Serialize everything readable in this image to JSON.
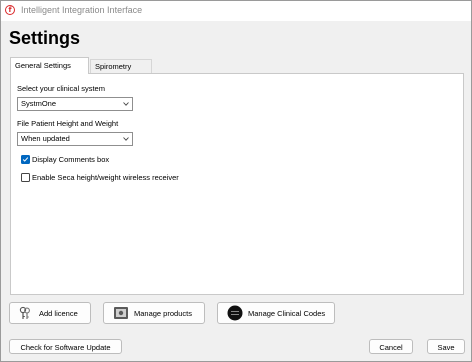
{
  "window": {
    "title": "Intelligent Integration Interface",
    "icon": "app-logo-icon"
  },
  "page": {
    "title": "Settings"
  },
  "tabs": [
    {
      "label": "General Settings",
      "active": true
    },
    {
      "label": "Spirometry Settings",
      "active": false
    }
  ],
  "general": {
    "clinical_system_label": "Select your clinical system",
    "clinical_system_value": "SystmOne",
    "file_height_weight_label": "File Patient Height and Weight",
    "file_height_weight_value": "When updated",
    "display_comments_label": "Display Comments box",
    "display_comments_checked": true,
    "seca_label": "Enable Seca height/weight wireless receiver",
    "seca_checked": false
  },
  "buttons": {
    "add_licence": "Add licence",
    "manage_products": "Manage products",
    "manage_clinical_codes": "Manage Clinical Codes",
    "check_update": "Check for Software Update",
    "cancel": "Cancel",
    "save": "Save"
  },
  "colors": {
    "checkbox_checked": "#0067c0",
    "app_icon": "#d9282a"
  }
}
